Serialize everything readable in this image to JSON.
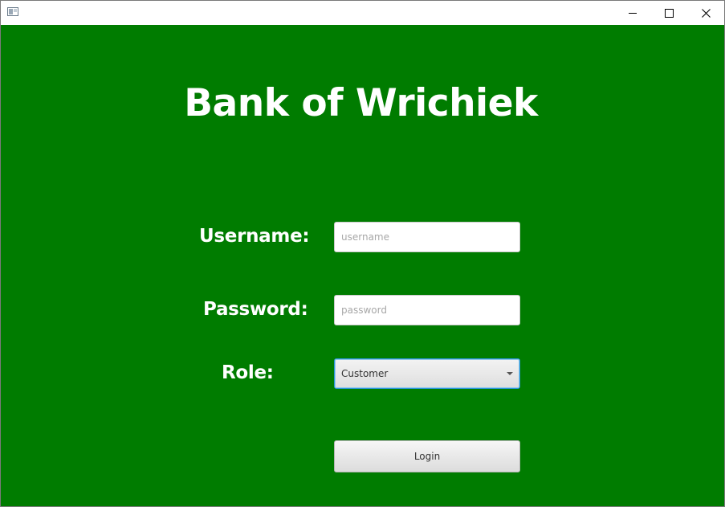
{
  "window": {
    "title_icon": "app-window-icon",
    "controls": {
      "minimize_icon": "minimize-icon",
      "maximize_icon": "maximize-icon",
      "close_icon": "close-icon"
    }
  },
  "header": {
    "title": "Bank of Wrichiek"
  },
  "form": {
    "username_label": "Username:",
    "username_placeholder": "username",
    "username_value": "",
    "password_label": "Password:",
    "password_placeholder": "password",
    "password_value": "",
    "role_label": "Role:",
    "role_selected": "Customer",
    "login_label": "Login"
  },
  "colors": {
    "background": "#007c00",
    "text": "#ffffff",
    "focus_border": "#2b96d8"
  }
}
